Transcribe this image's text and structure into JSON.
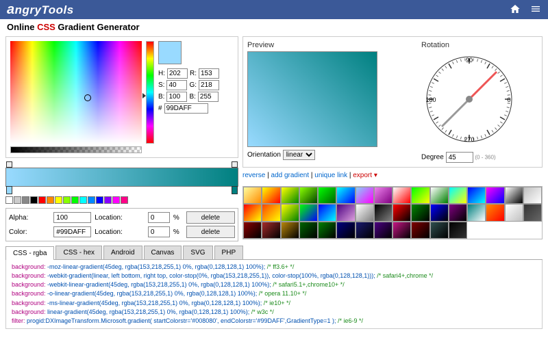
{
  "header": {
    "brand_prefix": "a",
    "brand_rest": "ngryTools"
  },
  "subtitle": {
    "pre": "Online ",
    "css": "CSS",
    "post": " Gradient Generator"
  },
  "picker": {
    "h_label": "H:",
    "h": "202",
    "s_label": "S:",
    "s": "40",
    "b_label": "B:",
    "b": "100",
    "r_label": "R:",
    "r": "153",
    "g_label": "G:",
    "g": "218",
    "bl_label": "B:",
    "bl": "255",
    "hex_prefix": "#",
    "hex": "99DAFF"
  },
  "params": {
    "alpha_label": "Alpha:",
    "alpha": "100",
    "loc_label": "Location:",
    "loc1": "0",
    "pct": "%",
    "color_label": "Color:",
    "color": "#99DAFF",
    "loc2": "0",
    "delete": "delete"
  },
  "preview": {
    "title": "Preview",
    "orient_label": "Orientation",
    "orient_value": "linear"
  },
  "rotation": {
    "title": "Rotation",
    "deg_label": "Degree",
    "deg": "45",
    "hint": "(0 - 360)",
    "n": "90",
    "e": "0",
    "s": "270",
    "w": "180"
  },
  "links": {
    "reverse": "reverse",
    "add": "add gradient",
    "unique": "unique link",
    "export": "export",
    "tri": "▾",
    "sep": " | "
  },
  "tabs": [
    "CSS - rgba",
    "CSS - hex",
    "Android",
    "Canvas",
    "SVG",
    "PHP"
  ],
  "code": {
    "l1p": "background:",
    "l1v": " -moz-linear-gradient(45deg, rgba(153,218,255,1) 0%, rgba(0,128,128,1) 100%);",
    "l1c": " /* ff3.6+ */",
    "l2p": "background:",
    "l2v": " -webkit-gradient(linear, left bottom, right top, color-stop(0%, rgba(153,218,255,1)), color-stop(100%, rgba(0,128,128,1)));",
    "l2c": " /* safari4+,chrome */",
    "l3p": "background:",
    "l3v": " -webkit-linear-gradient(45deg, rgba(153,218,255,1) 0%, rgba(0,128,128,1) 100%);",
    "l3c": " /* safari5.1+,chrome10+ */",
    "l4p": "background:",
    "l4v": " -o-linear-gradient(45deg, rgba(153,218,255,1) 0%, rgba(0,128,128,1) 100%);",
    "l4c": " /* opera 11.10+ */",
    "l5p": "background:",
    "l5v": " -ms-linear-gradient(45deg, rgba(153,218,255,1) 0%, rgba(0,128,128,1) 100%);",
    "l5c": " /* ie10+ */",
    "l6p": "background:",
    "l6v": " linear-gradient(45deg, rgba(153,218,255,1) 0%, rgba(0,128,128,1) 100%);",
    "l6c": " /* w3c */",
    "l7p": "filter:",
    "l7v": " progid:DXImageTransform.Microsoft.gradient( startColorstr='#008080', endColorstr='#99DAFF',GradientType=1 );",
    "l7c": " /* ie6-9 */"
  },
  "swatches": [
    "#fff",
    "#ccc",
    "#888",
    "#000",
    "#f00",
    "#f80",
    "#ff0",
    "#8f0",
    "#0f0",
    "#0ff",
    "#08f",
    "#00f",
    "#80f",
    "#f0f",
    "#f08"
  ],
  "presets": [
    [
      "#fffe9f,#ff8c00",
      "#ff0,#f00",
      "#ff0,#080",
      "#8f0,#040",
      "#0f0,#006400",
      "#0ff,#00f",
      "#87cefa,#f0f",
      "#ee82ee,#800080",
      "#fff,#f00",
      "#0f0,#ff0",
      "#fff,#008000",
      "#0ff,#ff0",
      "#00f,#0ff",
      "#f0f,#00f",
      "#fff,#000",
      "#c0c0c0,#fff"
    ],
    [
      "#f00,#ff0",
      "#ff4500,#ff0",
      "#ff0,#008000",
      "#0f0,#00f",
      "#00f,#0ff",
      "#4b0082,#dda0dd",
      "#fff,#808080",
      "#000,#808080",
      "#f00,#000",
      "#080,#000",
      "#00f,#000",
      "#800080,#000",
      "#008080,#fff",
      "#ff8c00,#f00",
      "#fff,#c0c0c0",
      "#333,#666"
    ],
    [
      "#8b0000,#000",
      "#a52a2a,#000",
      "#b8860b,#000",
      "#006400,#000",
      "#008000,#000",
      "#000080,#000",
      "#191970,#000",
      "#4b0082,#000",
      "#c71585,#000",
      "#800000,#000",
      "#2f4f4f,#000",
      "#000,#333",
      "",
      "",
      "",
      ""
    ]
  ]
}
